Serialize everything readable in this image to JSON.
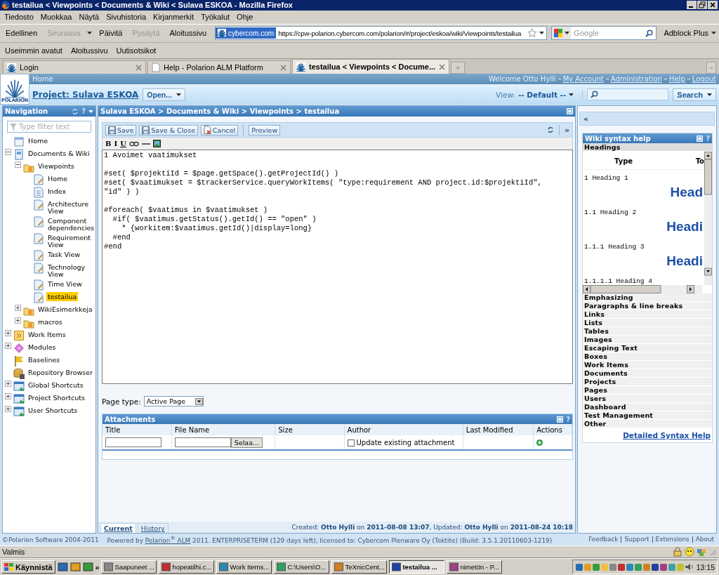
{
  "window": {
    "title": "testailua < Viewpoints < Documents & Wiki < Sulava ESKOA - Mozilla Firefox"
  },
  "menu": [
    "Tiedosto",
    "Muokkaa",
    "Näytä",
    "Sivuhistoria",
    "Kirjanmerkit",
    "Työkalut",
    "Ohje"
  ],
  "nav_toolbar": {
    "buttons": [
      {
        "label": "Edellinen",
        "disabled": false
      },
      {
        "label": "Seuraava",
        "disabled": true
      },
      {
        "label": "Päivitä",
        "disabled": false
      },
      {
        "label": "Pysäytä",
        "disabled": true
      },
      {
        "label": "Aloitussivu",
        "disabled": false
      }
    ],
    "site_badge": "cybercom.com",
    "url": "https://cpw-polarion.cybercom.com/polarion/#/project/eskoa/wiki/Viewpoints/testailua",
    "search_placeholder": "Google",
    "addon": "Adblock Plus"
  },
  "bookmarks": [
    "Useimmin avatut",
    "Aloitussivu",
    "Uutisotsikot"
  ],
  "tabs": [
    {
      "label": "Login",
      "selected": false
    },
    {
      "label": "Help - Polarion ALM Platform",
      "selected": false
    },
    {
      "label": "testailua < Viewpoints < Docume...",
      "selected": true
    }
  ],
  "header": {
    "logo_text": "POLARION",
    "breadcrumb": "Home",
    "welcome": "Welcome Otto Hylli",
    "links": [
      "My Account",
      "Administration",
      "Help",
      "Logout"
    ],
    "project": "Project: Sulava ESKOA",
    "open_button": "Open...",
    "view_label": "View:",
    "view_value": "-- Default --",
    "search_button": "Search"
  },
  "navigation": {
    "title": "Navigation",
    "help_glyph": "?",
    "filter_placeholder": "Type filter text",
    "tree": [
      {
        "label": "Home",
        "kind": "home",
        "selected": false
      },
      {
        "label": "Documents & Wiki",
        "kind": "docs",
        "selected": false,
        "expanded": true,
        "children": [
          {
            "label": "Viewpoints",
            "kind": "space",
            "selected": false,
            "expanded": true,
            "children": [
              {
                "label": "Home",
                "kind": "page",
                "selected": false
              },
              {
                "label": "Index",
                "kind": "index",
                "selected": false
              },
              {
                "label": "Architecture View",
                "kind": "page",
                "selected": false
              },
              {
                "label": "Component dependencies",
                "kind": "page",
                "selected": false
              },
              {
                "label": "Requirement View",
                "kind": "page",
                "selected": false
              },
              {
                "label": "Task View",
                "kind": "page",
                "selected": false
              },
              {
                "label": "Technology View",
                "kind": "page",
                "selected": false
              },
              {
                "label": "Time View",
                "kind": "page",
                "selected": false
              },
              {
                "label": "testailua",
                "kind": "page",
                "selected": true
              }
            ]
          },
          {
            "label": "WikiEsimerkkeja",
            "kind": "space",
            "selected": false,
            "expanded": false
          },
          {
            "label": "macros",
            "kind": "space",
            "selected": false,
            "expanded": false
          }
        ]
      },
      {
        "label": "Work Items",
        "kind": "workitems",
        "selected": false,
        "expanded": false
      },
      {
        "label": "Modules",
        "kind": "modules",
        "selected": false,
        "expanded": false
      },
      {
        "label": "Baselines",
        "kind": "baselines",
        "selected": false
      },
      {
        "label": "Repository Browser",
        "kind": "repo",
        "selected": false
      },
      {
        "label": "Global Shortcuts",
        "kind": "shortcuts",
        "selected": false,
        "expanded": false
      },
      {
        "label": "Project Shortcuts",
        "kind": "shortcuts",
        "selected": false,
        "expanded": false
      },
      {
        "label": "User Shortcuts",
        "kind": "shortcuts",
        "selected": false,
        "expanded": false
      }
    ]
  },
  "editor": {
    "path": "Sulava ESKOA > Documents & Wiki > Viewpoints > testailua",
    "collapse_glyph": "»",
    "buttons": [
      {
        "label": "Save",
        "kind": "save"
      },
      {
        "label": "Save & Close",
        "kind": "save"
      },
      {
        "label": "Cancel",
        "kind": "cancel"
      },
      {
        "label": "Preview",
        "kind": "plain"
      }
    ],
    "format_buttons": [
      "B",
      "I",
      "U"
    ],
    "content": "1 Avoimet vaatimukset\n\n#set( $projektiId = $page.getSpace().getProjectId() )\n#set( $vaatimukset = $trackerService.queryWorkItems( \"type:requirement AND project.id:$projektiId\",\n\"id\" ) )\n\n#foreach( $vaatimus in $vaatimukset )\n  #if( $vaatimus.getStatus().getId() == \"open\" )\n    * {workitem:$vaatimus.getId()|display=long}\n  #end\n#end",
    "page_type_label": "Page type:",
    "page_type": "Active Page",
    "attachments": {
      "title": "Attachments",
      "help_glyph": "?",
      "columns": [
        "Title",
        "File Name",
        "Size",
        "Author",
        "Last Modified",
        "Actions"
      ],
      "browse_button": "Selaa...",
      "update_label": "Update existing attachment",
      "update_checked": false
    },
    "tabs": [
      {
        "label": "Current",
        "selected": true
      },
      {
        "label": "History",
        "selected": false
      }
    ],
    "info": "Created: **Otto Hylli** on **2011-08-08 13:07**, Updated: **Otto Hylli** on **2011-08-24 10:18**"
  },
  "help": {
    "expand_glyph": "«",
    "title": "Wiki syntax help",
    "help_glyph": "?",
    "sections": [
      {
        "label": "Headings",
        "expanded": true
      },
      {
        "label": "Emphasizing",
        "expanded": false
      },
      {
        "label": "Paragraphs & line breaks",
        "expanded": false
      },
      {
        "label": "Links",
        "expanded": false
      },
      {
        "label": "Lists",
        "expanded": false
      },
      {
        "label": "Tables",
        "expanded": false
      },
      {
        "label": "Images",
        "expanded": false
      },
      {
        "label": "Escaping Text",
        "expanded": false
      },
      {
        "label": "Boxes",
        "expanded": false
      },
      {
        "label": "Work Items",
        "expanded": false
      },
      {
        "label": "Documents",
        "expanded": false
      },
      {
        "label": "Projects",
        "expanded": false
      },
      {
        "label": "Pages",
        "expanded": false
      },
      {
        "label": "Users",
        "expanded": false
      },
      {
        "label": "Dashboard",
        "expanded": false
      },
      {
        "label": "Test Management",
        "expanded": false
      },
      {
        "label": "Other",
        "expanded": false
      }
    ],
    "table": {
      "columns": [
        "Type",
        "To"
      ],
      "rows": [
        {
          "source": "1 Heading 1",
          "result": "Head"
        },
        {
          "source": "1.1 Heading 2",
          "result": "Headi"
        },
        {
          "source": "1.1.1 Heading 3",
          "result": "Headi"
        },
        {
          "source": "1.1.1.1 Heading 4"
        }
      ]
    },
    "link": "Detailed Syntax Help"
  },
  "footer": {
    "copyright": "©Polarion Software 2004-2011",
    "powered": "Powered by",
    "product": "Polarion$^{®}$ ALM",
    "license": "2011. ENTERPRISETERM (129 days left), licensed to: Cybercom Plenware Oy (Tektite) (Build: 3.5.1.20110603-1219)",
    "links": [
      "Feedback",
      "Support",
      "Extensions",
      "About"
    ]
  },
  "status_bar": "Valmis",
  "taskbar": {
    "start": "Käynnistä",
    "more_glyph": "»",
    "items": [
      {
        "label": "Saapuneet ...",
        "selected": false
      },
      {
        "label": "hopeatilhi.c...",
        "selected": false
      },
      {
        "label": "Work Items...",
        "selected": false
      },
      {
        "label": "C:\\Users\\O...",
        "selected": false
      },
      {
        "label": "TeXnicCent...",
        "selected": false
      },
      {
        "label": "testailua ...",
        "selected": true
      },
      {
        "label": "nimetön - P...",
        "selected": false
      }
    ],
    "clock": "13:15"
  }
}
